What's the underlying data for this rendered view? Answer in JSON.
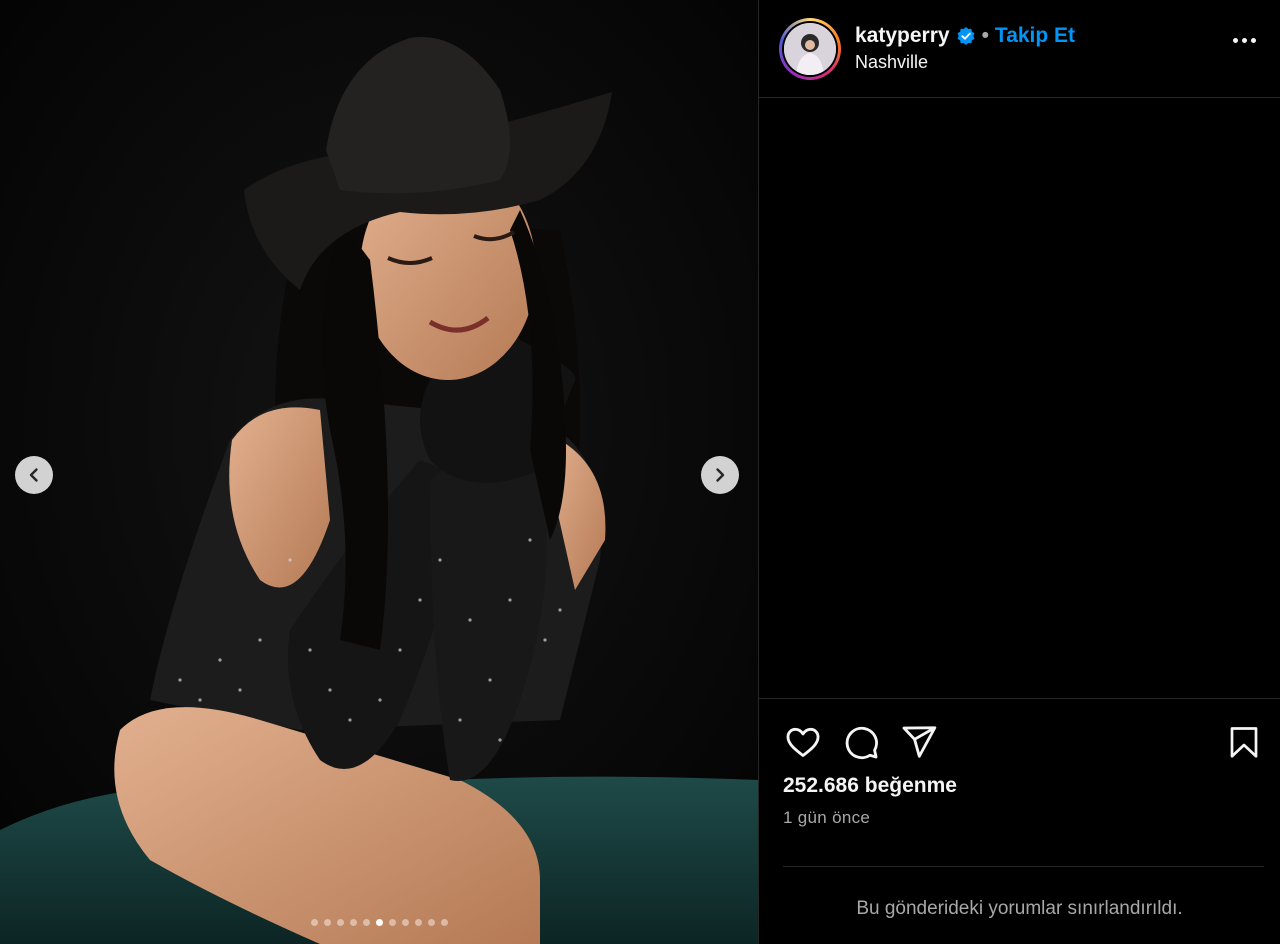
{
  "post": {
    "username": "katyperry",
    "follow_label": "Takip Et",
    "separator": "•",
    "location": "Nashville",
    "likes": "252.686 beğenme",
    "time_ago": "1 gün önce",
    "comments_restricted": "Bu gönderideki yorumlar sınırlandırıldı."
  },
  "carousel": {
    "total_slides": 11,
    "active_index": 5
  },
  "icons": {
    "prev": "chevron-left-icon",
    "next": "chevron-right-icon",
    "verified": "verified-badge-icon",
    "more": "more-options-icon",
    "like": "heart-icon",
    "comment": "comment-icon",
    "share": "share-icon",
    "save": "bookmark-icon"
  },
  "colors": {
    "accent": "#0095f6",
    "background": "#000000",
    "muted_text": "#a8a8a8"
  }
}
